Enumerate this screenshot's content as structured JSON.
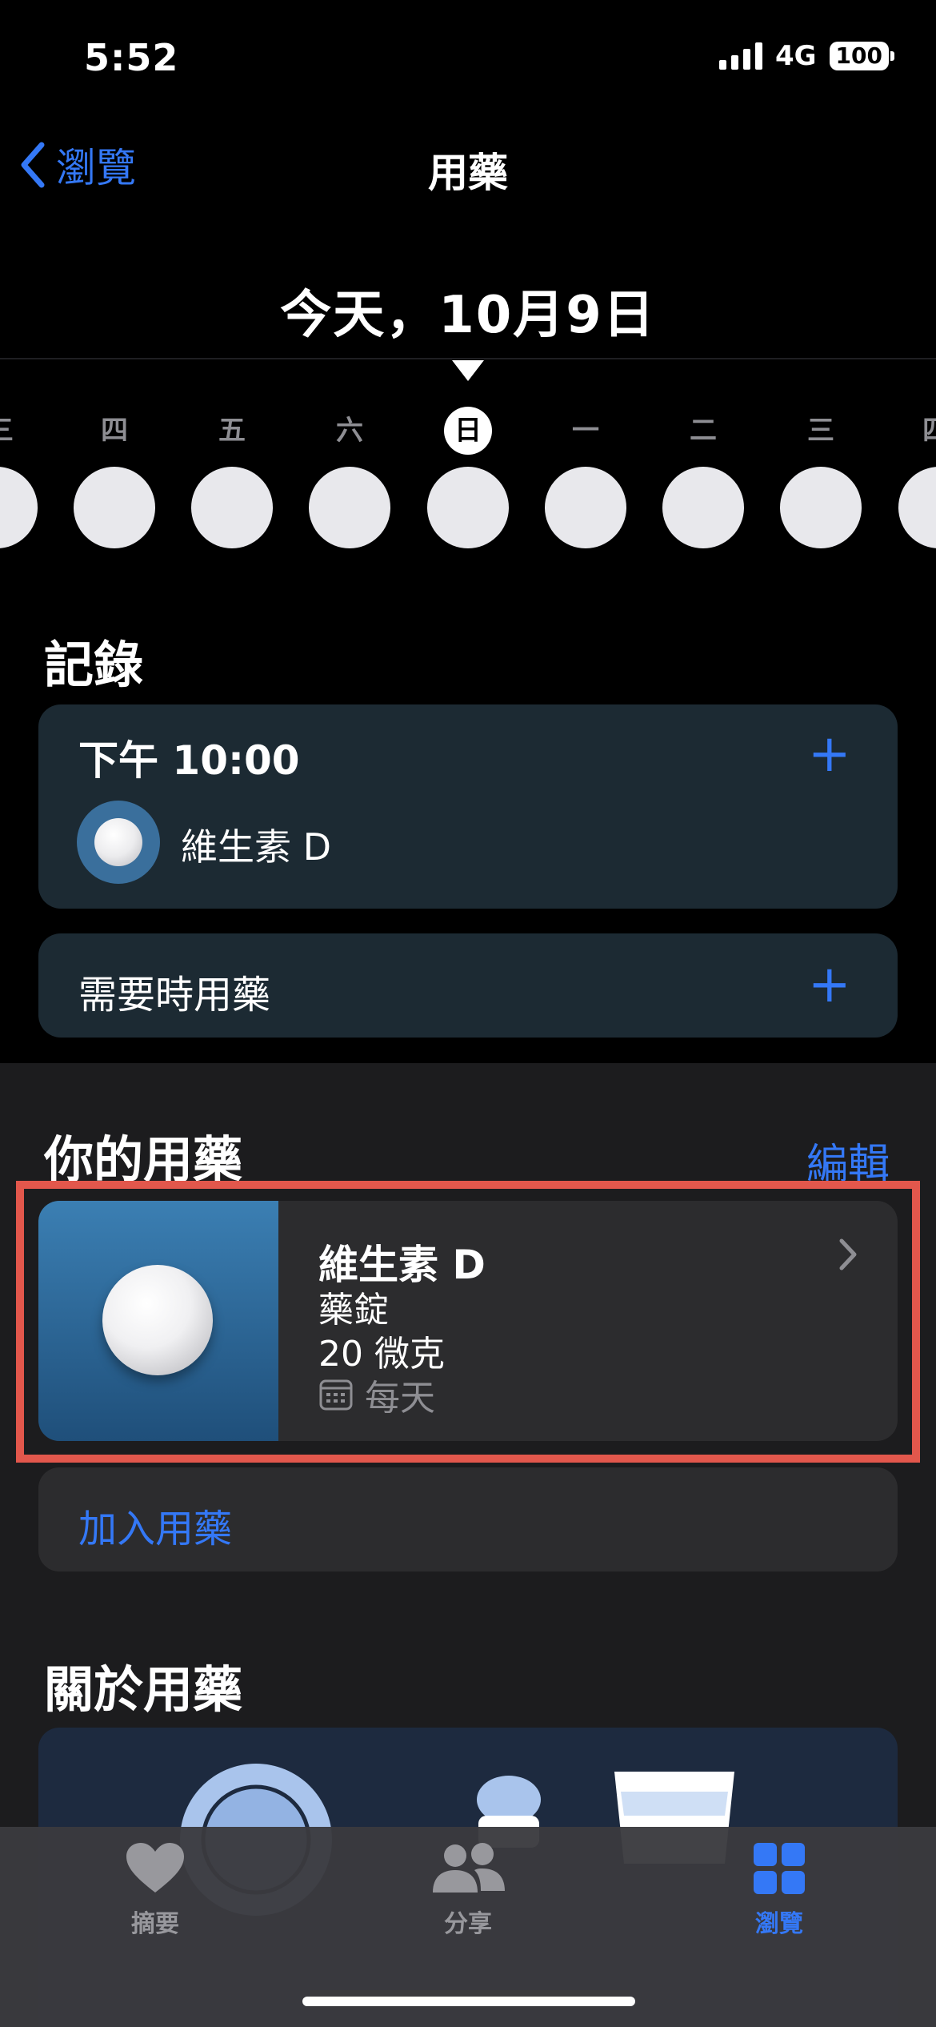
{
  "status_bar": {
    "time": "5:52",
    "network": "4G",
    "battery": "100"
  },
  "nav": {
    "back_label": "瀏覽",
    "title": "用藥"
  },
  "date": {
    "title": "今天，10月9日"
  },
  "week": {
    "days": [
      "三",
      "四",
      "五",
      "六",
      "日",
      "一",
      "二",
      "三",
      "四"
    ],
    "active_index": 4
  },
  "log": {
    "section_title": "記錄",
    "scheduled": {
      "time": "下午 10:00",
      "medication": "維生素 D"
    },
    "as_needed_label": "需要時用藥"
  },
  "your_meds": {
    "section_title": "你的用藥",
    "edit_label": "編輯",
    "items": [
      {
        "name": "維生素 D",
        "form": "藥錠",
        "dose": "20 微克",
        "schedule": "每天"
      }
    ],
    "add_label": "加入用藥"
  },
  "about": {
    "section_title": "關於用藥"
  },
  "tabbar": {
    "tabs": [
      {
        "label": "摘要",
        "icon": "heart-icon",
        "active": false
      },
      {
        "label": "分享",
        "icon": "people-icon",
        "active": false
      },
      {
        "label": "瀏覽",
        "icon": "grid-icon",
        "active": true
      }
    ]
  },
  "colors": {
    "accent": "#3478f6",
    "highlight": "#e2574c",
    "card": "#1c2a33"
  }
}
